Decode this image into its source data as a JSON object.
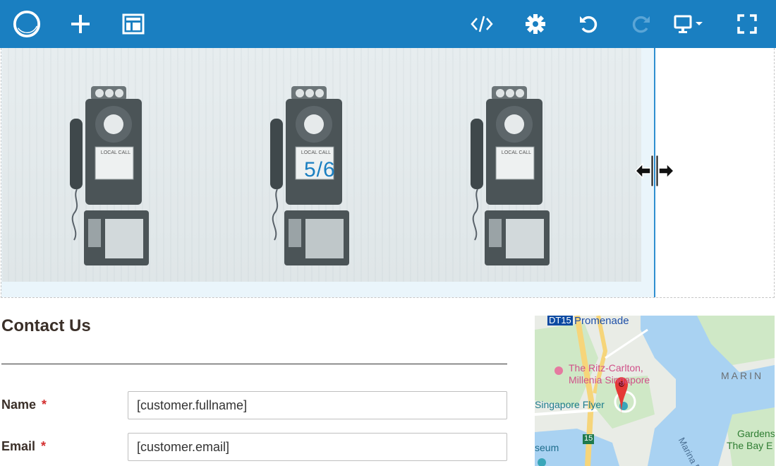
{
  "toolbar": {
    "buttons": [
      {
        "name": "logo-icon",
        "title": "Logo"
      },
      {
        "name": "add-icon",
        "title": "Add"
      },
      {
        "name": "layout-icon",
        "title": "Layout"
      },
      {
        "name": "code-icon",
        "title": "Code view"
      },
      {
        "name": "gear-icon",
        "title": "Settings"
      },
      {
        "name": "undo-icon",
        "title": "Undo"
      },
      {
        "name": "redo-icon",
        "title": "Redo"
      },
      {
        "name": "device-icon",
        "title": "Device preview"
      },
      {
        "name": "fullscreen-icon",
        "title": "Fullscreen"
      }
    ],
    "color": "#1a7fc1"
  },
  "editor": {
    "column_size_label": "5/6",
    "selected_column_border": "#2f8fd0",
    "phone_signs": [
      "LOCAL CALL",
      "LOCAL CALL",
      "LOCAL CALL"
    ]
  },
  "contact": {
    "title": "Contact Us",
    "fields": [
      {
        "label": "Name",
        "required_mark": "*",
        "value": "[customer.fullname]"
      },
      {
        "label": "Email",
        "required_mark": "*",
        "value": "[customer.email]"
      }
    ]
  },
  "map": {
    "labels": {
      "station_code": "DT15",
      "station_name": "Promenade",
      "hotel_line1": "The Ritz-Carlton,",
      "hotel_line2": "Millenia Singapore",
      "flyer": "Singapore Flyer",
      "marina": "MARIN",
      "gardens_line1": "Gardens",
      "gardens_line2": "The Bay E",
      "museum": "seum",
      "road_number": "15",
      "marina_road": "Marina B"
    },
    "water_color": "#a9d2f2",
    "park_color": "#cfe8c6",
    "road_color": "#f6d57a"
  }
}
